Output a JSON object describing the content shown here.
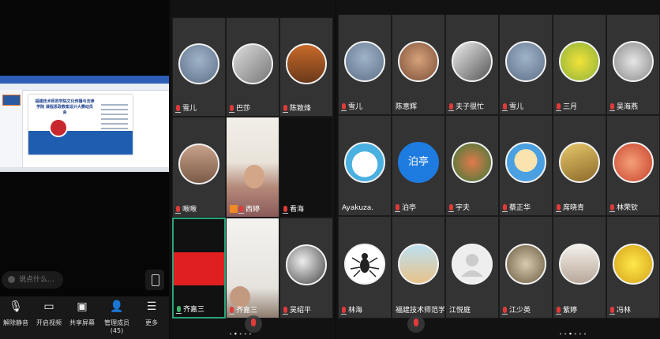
{
  "left_panel": {
    "shared_slide": {
      "title": "福建技术师范学院文化传播与法律学院 课程思政教案设计大赛动员会"
    },
    "chat_placeholder": "说点什么...",
    "toolbar": [
      {
        "label": "解除静音",
        "icon": "mic-muted-icon"
      },
      {
        "label": "开启视频",
        "icon": "camera-off-icon"
      },
      {
        "label": "共享屏幕",
        "icon": "share-screen-icon"
      },
      {
        "label": "管理成员(45)",
        "icon": "members-icon"
      },
      {
        "label": "更多",
        "icon": "more-icon"
      }
    ]
  },
  "middle_panel": {
    "tiles": [
      {
        "name": "雪儿"
      },
      {
        "name": "巴莎"
      },
      {
        "name": "陈致烽"
      },
      {
        "name": "啾啾"
      },
      {
        "name": "西婷"
      },
      {
        "name": "看海"
      },
      {
        "name": "齐嘉三"
      },
      {
        "name": "齐嘉三"
      },
      {
        "name": "吴绍平"
      }
    ]
  },
  "right_panel": {
    "tiles": [
      {
        "name": "雪儿"
      },
      {
        "name": "陈意辉"
      },
      {
        "name": "夫子很忙"
      },
      {
        "name": "雪儿"
      },
      {
        "name": "三月"
      },
      {
        "name": "吴海燕"
      },
      {
        "name": "Ayakuza."
      },
      {
        "name": "泊亭",
        "avatar_text": "泊亭"
      },
      {
        "name": "宇夫"
      },
      {
        "name": "蔡正华"
      },
      {
        "name": "席晓青"
      },
      {
        "name": "林荣钦"
      },
      {
        "name": "林海"
      },
      {
        "name": "福建技术师范学..."
      },
      {
        "name": "江悦庭"
      },
      {
        "name": "江少英"
      },
      {
        "name": "紫婷"
      },
      {
        "name": "冯林"
      }
    ]
  },
  "colors": {
    "accent_green": "#2aa37a",
    "mic_muted": "#e03a3a",
    "avatar_blue": "#1e7be0"
  }
}
